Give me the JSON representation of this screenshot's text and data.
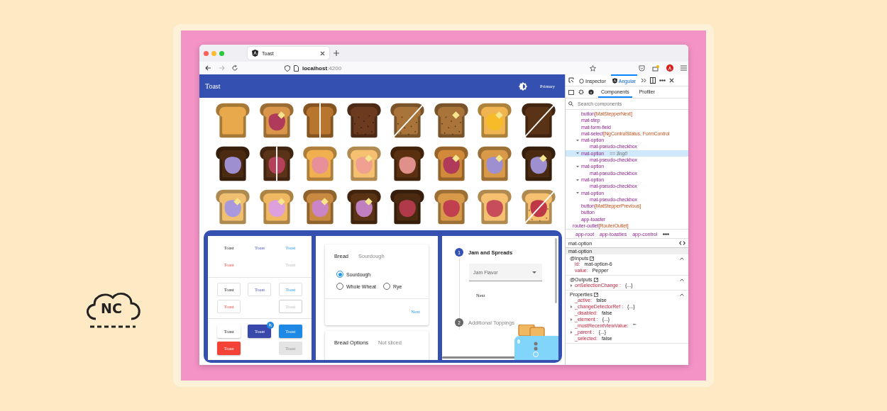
{
  "logo": {
    "text": "NC"
  },
  "browser": {
    "tab": {
      "title": "Toast"
    },
    "url": {
      "host": "localhost",
      "port": ":4200"
    }
  },
  "app": {
    "title": "Toast",
    "theme_label": "Primary"
  },
  "toast_rows": [
    [
      {
        "color": "#e8a84c",
        "butter": false
      },
      {
        "color": "#d9964a",
        "jam": {
          "color": "#b03a5a"
        },
        "butter": true
      },
      {
        "color": "#b8752e",
        "butter": false,
        "slice": {
          "kind": "vertical"
        }
      },
      {
        "color": "#6b3a1f",
        "butter": false,
        "seeds": true
      },
      {
        "color": "#a8743a",
        "butter": false,
        "seeds": true,
        "slice": {
          "kind": "diagonal"
        }
      },
      {
        "color": "#a8743a",
        "butter": true,
        "seeds": true
      },
      {
        "color": "#f0b450",
        "jam": {
          "color": "#f7bb2a"
        },
        "butter": true
      },
      {
        "color": "#5a3316",
        "butter": false,
        "slice": {
          "kind": "diagonal"
        }
      }
    ],
    [
      {
        "color": "#4a2a10",
        "jam": {
          "color": "#9d8fd0"
        },
        "butter": false
      },
      {
        "color": "#5a3318",
        "jam": {
          "color": "#b5405a"
        },
        "butter": false,
        "slice": {
          "kind": "vertical"
        }
      },
      {
        "color": "#f0b050",
        "jam": {
          "color": "#e7909a"
        },
        "butter": false
      },
      {
        "color": "#f5c070",
        "jam": {
          "color": "#f0a090"
        },
        "butter": true
      },
      {
        "color": "#5a3010",
        "jam": {
          "color": "#e0908a"
        },
        "butter": false
      },
      {
        "color": "#d08a3a",
        "jam": {
          "color": "#b03a5a"
        },
        "butter": true
      },
      {
        "color": "#d89a48",
        "jam": {
          "color": "#9d8fd0"
        },
        "butter": true
      },
      {
        "color": "#4a2a10",
        "jam": {
          "color": "#9d8fd0"
        },
        "butter": true
      }
    ],
    [
      {
        "color": "#f0c070",
        "jam": {
          "color": "#a898dc"
        },
        "butter": true
      },
      {
        "color": "#f0b860",
        "jam": {
          "color": "#dea0dc"
        },
        "butter": true
      },
      {
        "color": "#c88a40",
        "jam": {
          "color": "#c985c5"
        },
        "butter": true
      },
      {
        "color": "#5a3214",
        "jam": {
          "color": "#c080c0"
        },
        "butter": true
      },
      {
        "color": "#4a2a10",
        "jam": {
          "color": "#b03a4a"
        },
        "butter": false
      },
      {
        "color": "#d89a48",
        "jam": {
          "color": "#c04050"
        },
        "butter": false
      },
      {
        "color": "#f5c070",
        "jam": {
          "color": "#c84d5a"
        },
        "butter": false
      },
      {
        "color": "#f5c070",
        "jam": {
          "color": "#c03848"
        },
        "butter": false,
        "seeds": true,
        "slice": {
          "kind": "diagonal"
        }
      }
    ]
  ],
  "button_sections": [
    {
      "kind": "text",
      "rows": [
        [
          {
            "label": "Toast",
            "kind": "basic",
            "disabled": false
          },
          {
            "label": "Toast",
            "kind": "primary",
            "disabled": false
          },
          {
            "label": "Toast",
            "kind": "accent",
            "disabled": false
          }
        ],
        [
          {
            "label": "Toast",
            "kind": "warn",
            "disabled": false
          },
          null,
          {
            "label": "Toast",
            "kind": "basic",
            "disabled": true
          }
        ]
      ]
    },
    {
      "kind": "stroked",
      "rows": [
        [
          {
            "label": "Toast",
            "kind": "basic",
            "disabled": false
          },
          {
            "label": "Toast",
            "kind": "primary",
            "disabled": false
          },
          {
            "label": "Toast",
            "kind": "accent",
            "disabled": false
          }
        ],
        [
          {
            "label": "Toast",
            "kind": "warn",
            "disabled": false
          },
          null,
          {
            "label": "Toast",
            "kind": "basic",
            "disabled": true
          }
        ]
      ]
    },
    {
      "kind": "flat",
      "rows": [
        [
          {
            "label": "Toast",
            "kind": "basic",
            "disabled": false
          },
          {
            "label": "Toast",
            "kind": "primary",
            "disabled": false,
            "badge": true
          },
          {
            "label": "Toast",
            "kind": "accent",
            "disabled": false
          }
        ],
        [
          {
            "label": "Toast",
            "kind": "warn",
            "disabled": false
          },
          null,
          {
            "label": "Toast",
            "kind": "basic",
            "disabled": true
          }
        ]
      ]
    }
  ],
  "bread_card": {
    "title": "Bread",
    "value": "Sourdough",
    "options": [
      {
        "label": "Sourdough",
        "selected": true
      },
      {
        "label": "Whole Wheat",
        "selected": false
      },
      {
        "label": "Rye",
        "selected": false
      }
    ],
    "action": "Next"
  },
  "options_card": {
    "title": "Bread Options",
    "value": "Not sliced"
  },
  "stepper": {
    "steps": [
      {
        "number": "1",
        "title": "Jam and Spreads",
        "active": true
      },
      {
        "number": "2",
        "title": "Additional Toppings",
        "active": false
      }
    ],
    "select": {
      "placeholder": "Jam Flavor"
    },
    "action": "Next"
  },
  "devtools": {
    "tabs": [
      {
        "label": "Inspector",
        "selected": false
      },
      {
        "label": "Angular",
        "selected": true
      }
    ],
    "subtabs": [
      {
        "label": "Components",
        "selected": true
      },
      {
        "label": "Profiler",
        "selected": false
      }
    ],
    "search": {
      "placeholder": "Search components"
    },
    "tree": [
      {
        "children": [
          {
            "name": "button",
            "attrs": "[MatStepperNext]",
            "selected": false
          },
          {
            "name": "mat-step",
            "selected": false
          },
          {
            "name": "mat-form-field",
            "selected": false
          },
          {
            "name": "mat-select",
            "attrs": "[NgControlStatus, FormControl",
            "selected": false
          },
          {
            "name": "mat-option",
            "expanded": true,
            "selected": false,
            "children": [
              {
                "name": "mat-pseudo-checkbox",
                "selected": false
              }
            ]
          },
          {
            "name": "mat-option",
            "ref": "== $ng0",
            "expanded": true,
            "selected": true,
            "children": [
              {
                "name": "mat-pseudo-checkbox",
                "selected": false
              }
            ]
          },
          {
            "name": "mat-option",
            "expanded": true,
            "selected": false,
            "children": [
              {
                "name": "mat-pseudo-checkbox",
                "selected": false
              }
            ]
          },
          {
            "name": "mat-option",
            "expanded": true,
            "selected": false,
            "children": [
              {
                "name": "mat-pseudo-checkbox",
                "selected": false
              }
            ]
          },
          {
            "name": "mat-option",
            "expanded": true,
            "selected": false,
            "children": [
              {
                "name": "mat-pseudo-checkbox",
                "selected": false
              }
            ]
          },
          {
            "name": "button",
            "attrs": "[MatStepperPrevious]",
            "selected": false
          },
          {
            "name": "button",
            "selected": false
          },
          {
            "name": "app-toaster",
            "selected": false
          }
        ]
      },
      {
        "name": "router-outlet",
        "attrs": "[RouterOutlet]",
        "selected": false
      }
    ],
    "breadcrumb": [
      "app-root",
      "app-toasties",
      "app-control"
    ],
    "selected_component": "mat-option",
    "panel_title": "mat-option",
    "sections": [
      {
        "title": "@Inputs",
        "expanded": true,
        "props": [
          {
            "key": "id:",
            "value": "mat-option-6",
            "expandable": false
          },
          {
            "key": "value:",
            "value": "Pepper",
            "expandable": false
          }
        ]
      },
      {
        "title": "@Outputs",
        "expanded": true,
        "props": [
          {
            "key": "onSelectionChange :",
            "value": "{...}",
            "expandable": true
          }
        ]
      },
      {
        "title": "Properties",
        "expanded": true,
        "props": [
          {
            "key": "_active:",
            "value": "false",
            "expandable": false
          },
          {
            "key": "_changeDetectorRef :",
            "value": "{...}",
            "expandable": true
          },
          {
            "key": "_disabled:",
            "value": "false",
            "expandable": false
          },
          {
            "key": "_element :",
            "value": "{...}",
            "expandable": true
          },
          {
            "key": "_mostRecentViewValue:",
            "value": "\"\"",
            "expandable": false
          },
          {
            "key": "_parent :",
            "value": "{...}",
            "expandable": true
          },
          {
            "key": "_selected:",
            "value": "false",
            "expandable": false
          }
        ]
      }
    ]
  }
}
